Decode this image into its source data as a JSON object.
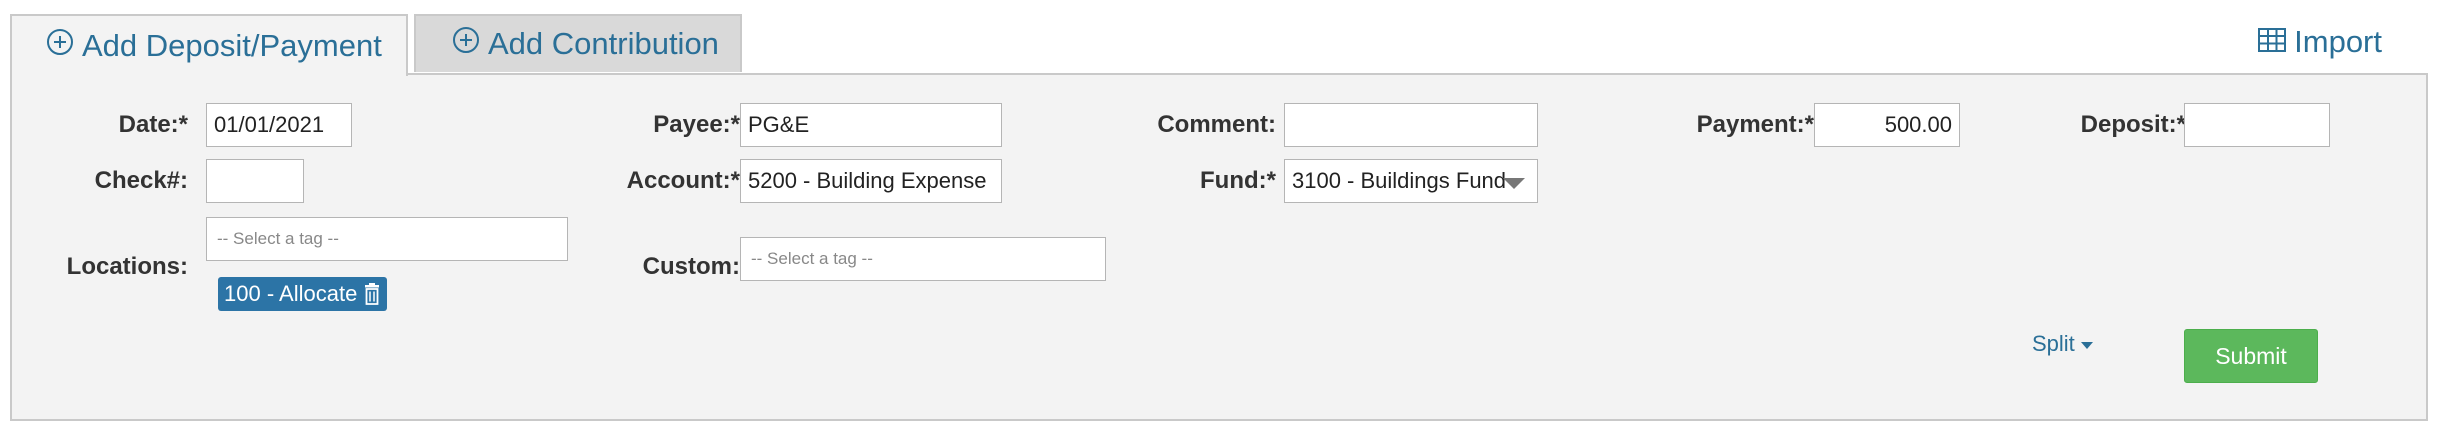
{
  "tabs": {
    "add_deposit_label": "Add Deposit/Payment",
    "add_contribution_label": "Add Contribution"
  },
  "import_label": "Import",
  "form": {
    "date": {
      "label": "Date:*",
      "value": "01/01/2021"
    },
    "payee": {
      "label": "Payee:*",
      "value": "PG&E"
    },
    "comment": {
      "label": "Comment:",
      "value": ""
    },
    "payment": {
      "label": "Payment:*",
      "value": "500.00"
    },
    "deposit": {
      "label": "Deposit:*",
      "value": ""
    },
    "check": {
      "label": "Check#:",
      "value": ""
    },
    "account": {
      "label": "Account:*",
      "value": "5200 - Building Expense"
    },
    "fund": {
      "label": "Fund:*",
      "value": "3100 - Buildings Fund"
    },
    "locations": {
      "label": "Locations:",
      "placeholder": "-- Select a tag --",
      "tags": [
        "100 - Allocate"
      ]
    },
    "custom": {
      "label": "Custom:",
      "placeholder": "-- Select a tag --"
    },
    "split_label": "Split",
    "submit_label": "Submit"
  },
  "colors": {
    "link": "#2a6f97",
    "panel_bg": "#f3f3f3",
    "tag_bg": "#2c74a6",
    "submit_bg": "#5cb85c"
  },
  "icons": {
    "tab_plus": "circle-plus-icon",
    "import": "table-icon",
    "tag_remove": "trash-icon",
    "split": "caret-down-icon",
    "select": "caret-down-icon"
  }
}
